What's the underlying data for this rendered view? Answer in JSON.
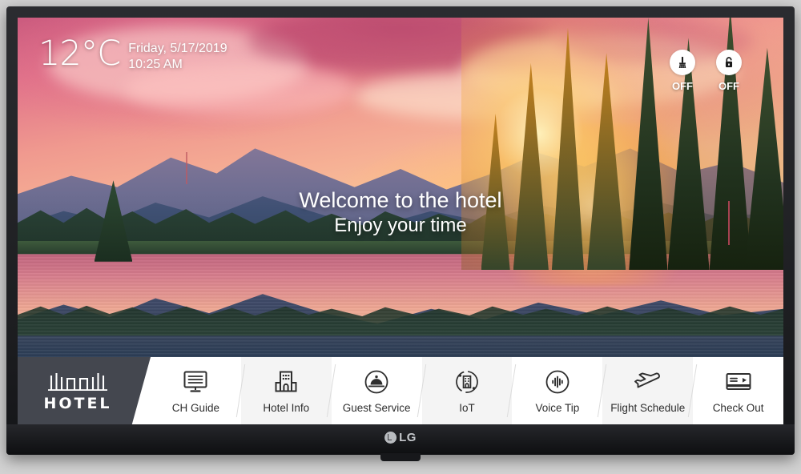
{
  "device": {
    "brand": "LG",
    "brand_mark": "lg-logo"
  },
  "status_bar": {
    "temperature": "12°C",
    "date": "Friday, 5/17/2019",
    "time": "10:25 AM",
    "services": [
      {
        "icon": "make-up-room-icon",
        "state": "OFF"
      },
      {
        "icon": "do-not-disturb-unlocked-icon",
        "state": "OFF"
      }
    ]
  },
  "welcome": {
    "title": "Welcome to the hotel",
    "subtitle": "Enjoy your time"
  },
  "nav_bar": {
    "brand_label": "HOTEL",
    "brand_logo_icon": "hotel-building-logo-icon",
    "items": [
      {
        "label": "CH Guide",
        "icon": "channel-guide-icon"
      },
      {
        "label": "Hotel Info",
        "icon": "hotel-building-icon"
      },
      {
        "label": "Guest Service",
        "icon": "service-bell-icon"
      },
      {
        "label": "IoT",
        "icon": "iot-orbit-icon"
      },
      {
        "label": "Voice Tip",
        "icon": "voice-waveform-icon"
      },
      {
        "label": "Flight Schedule",
        "icon": "airplane-icon"
      },
      {
        "label": "Check Out",
        "icon": "checkout-card-icon"
      }
    ]
  },
  "colors": {
    "brand_panel": "#44474f",
    "nav_background": "#ffffff",
    "nav_tint": "#f4f4f4",
    "icon_stroke": "#2e2e2e",
    "overlay_text": "#ffffff"
  }
}
